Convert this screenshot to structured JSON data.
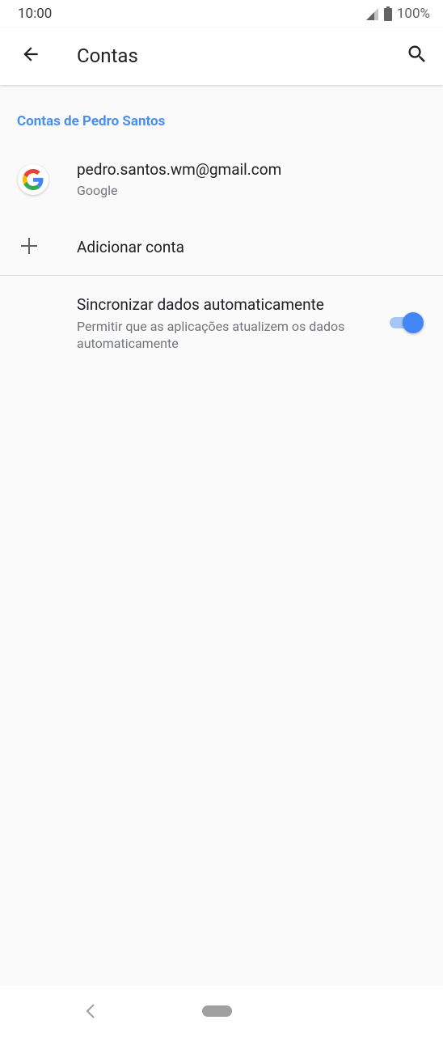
{
  "status_bar": {
    "time": "10:00",
    "battery": "100%",
    "icons": [
      "signal-icon",
      "battery-icon"
    ]
  },
  "app_bar": {
    "title": "Contas",
    "icons": [
      "back-arrow-icon",
      "search-icon"
    ]
  },
  "section": {
    "header": "Contas de Pedro Santos"
  },
  "account": {
    "email": "pedro.santos.wm@gmail.com",
    "type": "Google",
    "icon": "google-logo-icon"
  },
  "add_account": {
    "label": "Adicionar conta",
    "icon": "plus-icon"
  },
  "sync": {
    "title": "Sincronizar dados automaticamente",
    "description": "Permitir que as aplicações atualizem os dados automaticamente",
    "enabled": true
  },
  "colors": {
    "accent": "#4285f4",
    "section_header": "#4a8ff0",
    "background": "#fafafa"
  },
  "nav_bar": {
    "icons": [
      "nav-back-icon",
      "nav-home-pill"
    ]
  }
}
